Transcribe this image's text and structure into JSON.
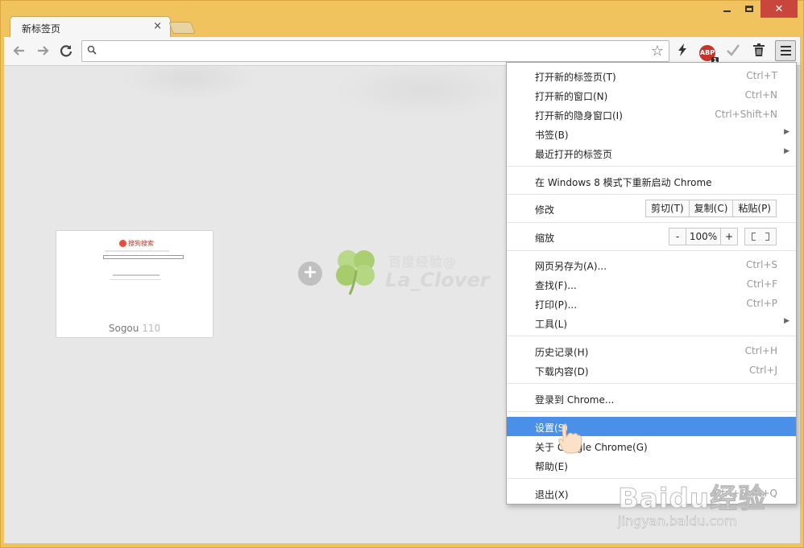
{
  "tab": {
    "title": "新标签页",
    "close": "×"
  },
  "window": {
    "close": "✕"
  },
  "omnibox": {
    "value": "",
    "placeholder": ""
  },
  "thumbnail": {
    "name": "Sogou",
    "count": "110",
    "logo_text": "搜狗搜索"
  },
  "watermark": {
    "line1": "百度经验@",
    "line2": "La_Clover"
  },
  "baidu_watermark": {
    "logo": "Baidu经验",
    "url": "jingyan.baidu.com"
  },
  "menu": {
    "items": [
      {
        "label": "打开新的标签页(T)",
        "shortcut": "Ctrl+T"
      },
      {
        "label": "打开新的窗口(N)",
        "shortcut": "Ctrl+N"
      },
      {
        "label": "打开新的隐身窗口(I)",
        "shortcut": "Ctrl+Shift+N"
      },
      {
        "label": "书签(B)",
        "shortcut": ""
      },
      {
        "label": "最近打开的标签页",
        "shortcut": ""
      },
      {
        "label": "在 Windows 8 模式下重新启动 Chrome",
        "shortcut": ""
      },
      {
        "label": "修改",
        "shortcut": ""
      },
      {
        "label": "缩放",
        "shortcut": ""
      },
      {
        "label": "网页另存为(A)...",
        "shortcut": "Ctrl+S"
      },
      {
        "label": "查找(F)...",
        "shortcut": "Ctrl+F"
      },
      {
        "label": "打印(P)...",
        "shortcut": "Ctrl+P"
      },
      {
        "label": "工具(L)",
        "shortcut": ""
      },
      {
        "label": "历史记录(H)",
        "shortcut": "Ctrl+H"
      },
      {
        "label": "下载内容(D)",
        "shortcut": "Ctrl+J"
      },
      {
        "label": "登录到 Chrome...",
        "shortcut": ""
      },
      {
        "label": "设置(S)",
        "shortcut": ""
      },
      {
        "label": "关于 Google Chrome(G)",
        "shortcut": ""
      },
      {
        "label": "帮助(E)",
        "shortcut": ""
      },
      {
        "label": "退出(X)",
        "shortcut": "Ctrl+Shift+Q"
      }
    ],
    "edit": {
      "cut": "剪切(T)",
      "copy": "复制(C)",
      "paste": "粘贴(P)"
    },
    "zoom": {
      "minus": "-",
      "level": "100%",
      "plus": "+"
    }
  },
  "colors": {
    "frame": "#f1c35f",
    "highlight": "#4a90e9",
    "close": "#c9463d"
  }
}
